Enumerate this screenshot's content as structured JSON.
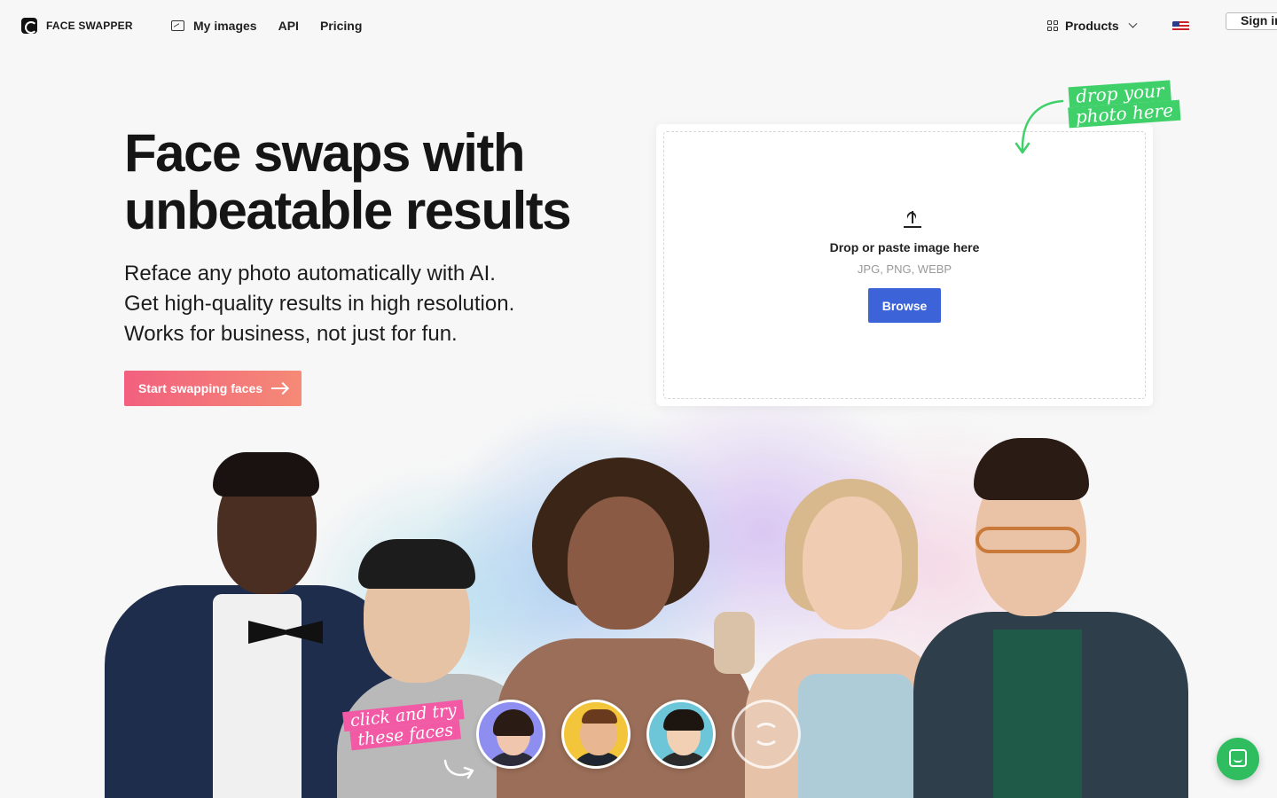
{
  "nav": {
    "brand": "FACE SWAPPER",
    "links": [
      {
        "label": "My images",
        "icon": "image-icon"
      },
      {
        "label": "API"
      },
      {
        "label": "Pricing"
      }
    ],
    "products_label": "Products",
    "language_flag": "us-flag-icon",
    "sign_in": "Sign in"
  },
  "hero": {
    "title_line1": "Face swaps with",
    "title_line2": "unbeatable results",
    "sub_line1": "Reface any photo automatically with AI.",
    "sub_line2": "Get high-quality results in high resolution.",
    "sub_line3": "Works for business, not just for fun.",
    "cta_label": "Start swapping faces"
  },
  "upload": {
    "title": "Drop or paste image here",
    "formats": "JPG, PNG, WEBP",
    "browse_label": "Browse",
    "sticker_line1": "drop your",
    "sticker_line2": "photo here"
  },
  "faces": {
    "sticker_line1": "click and try",
    "sticker_line2": "these faces",
    "options": [
      {
        "name": "face-option-1",
        "bg": "#8e8ef0"
      },
      {
        "name": "face-option-2",
        "bg": "#f2c53a"
      },
      {
        "name": "face-option-3",
        "bg": "#6cc6d8"
      }
    ]
  },
  "colors": {
    "accent_blue": "#3d63d8",
    "cta_gradient_start": "#f2607e",
    "cta_gradient_end": "#f58a76",
    "sticker_green": "#3fd06a",
    "sticker_pink": "#f25aa6",
    "chat_green": "#2fbd60"
  }
}
